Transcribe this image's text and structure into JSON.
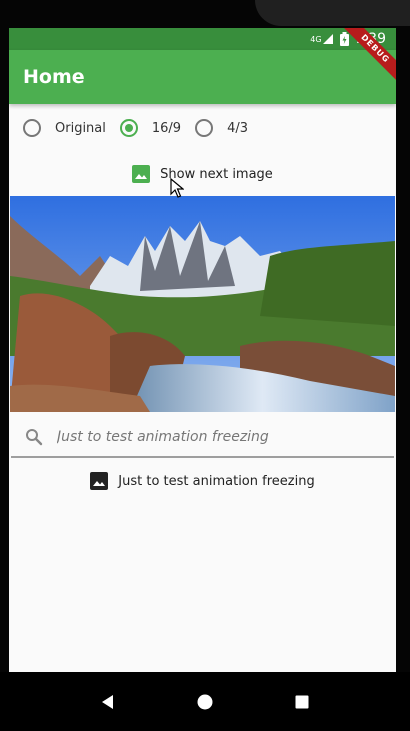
{
  "status_bar": {
    "network": "4G",
    "time": "7:39"
  },
  "debug_banner": "DEBUG",
  "app_bar": {
    "title": "Home"
  },
  "aspect_options": {
    "selected": "16/9",
    "items": [
      {
        "label": "Original",
        "selected": false
      },
      {
        "label": "16/9",
        "selected": true
      },
      {
        "label": "4/3",
        "selected": false
      }
    ]
  },
  "next_image_button": {
    "label": "Show next image",
    "icon": "image-icon",
    "accent": "#4caf50"
  },
  "search": {
    "placeholder": "Just to test animation freezing",
    "value": ""
  },
  "freeze_button": {
    "label": "Just to test animation freezing",
    "icon": "image-icon"
  },
  "colors": {
    "primary": "#4caf50",
    "primary_dark": "#388e3c",
    "background": "#fafafa"
  },
  "nav_bar": {
    "items": [
      "back-icon",
      "home-icon",
      "recents-icon"
    ]
  }
}
